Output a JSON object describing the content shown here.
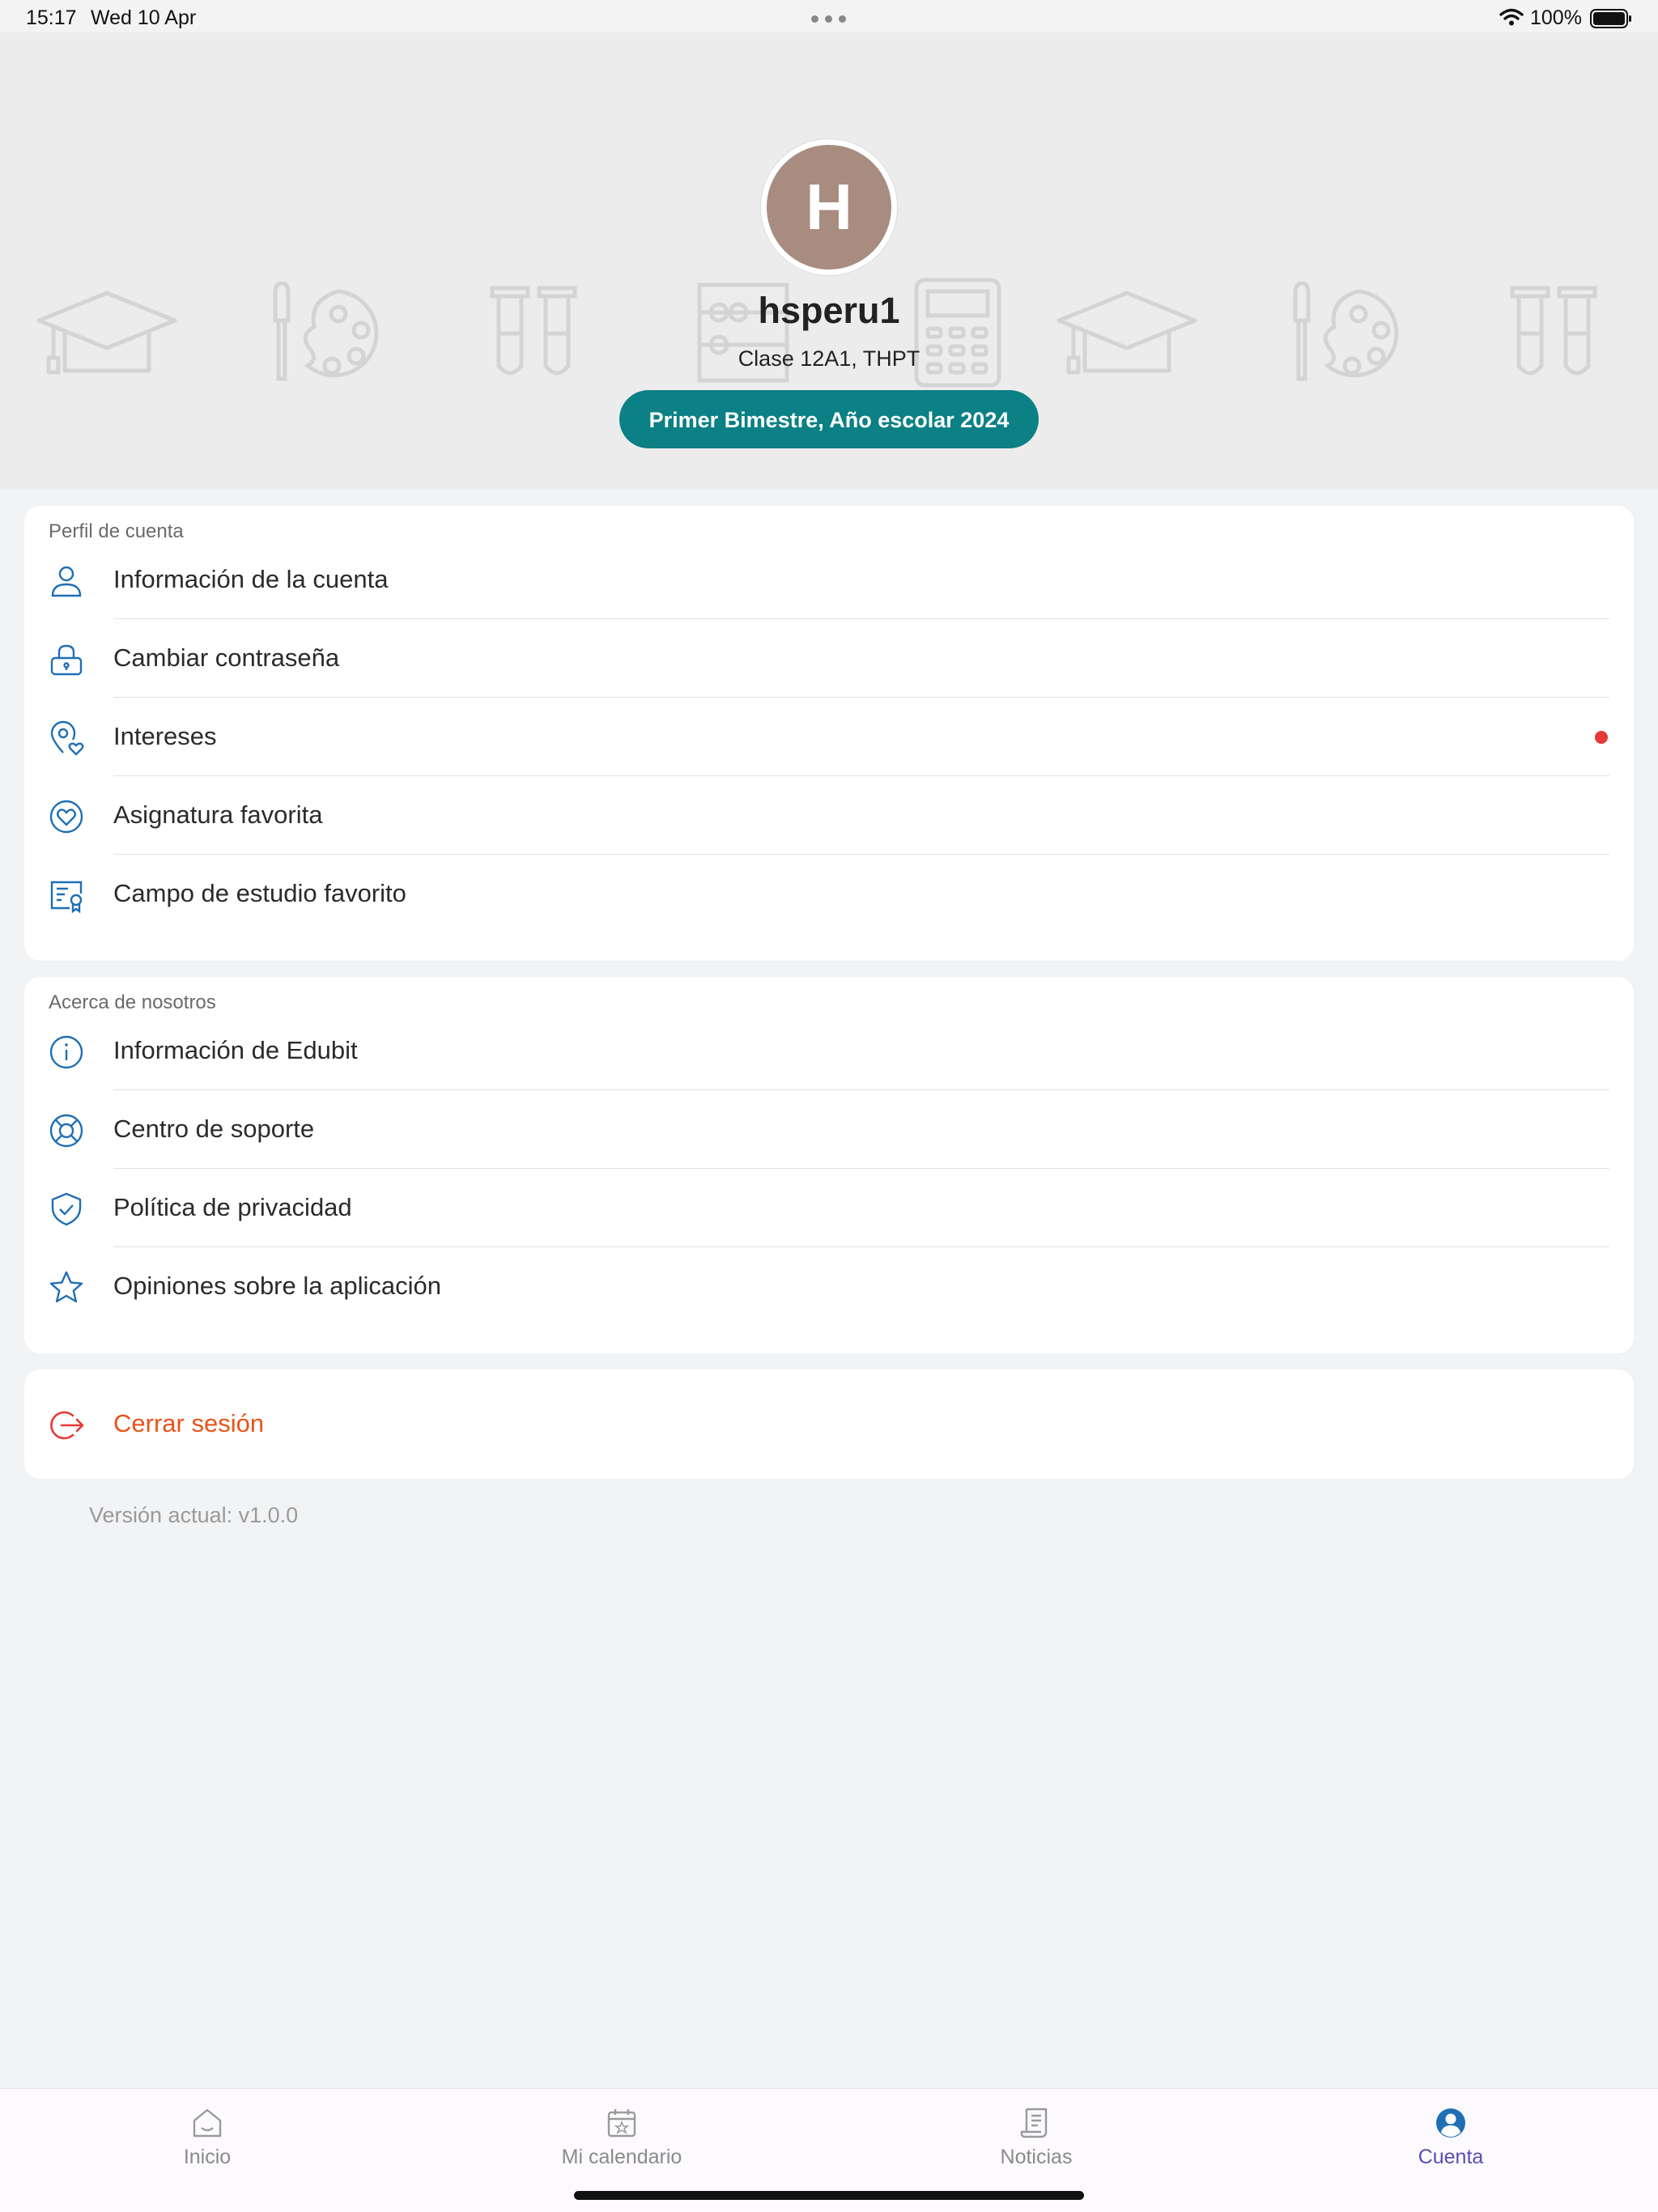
{
  "status_bar": {
    "time": "15:17",
    "date": "Wed 10 Apr",
    "battery": "100%"
  },
  "profile": {
    "avatar_initial": "H",
    "username": "hsperu1",
    "class_info": "Clase 12A1, THPT",
    "term": "Primer Bimestre, Año escolar 2024"
  },
  "account_section": {
    "title": "Perfil de cuenta",
    "items": [
      {
        "label": "Información de la cuenta",
        "icon": "user-icon"
      },
      {
        "label": "Cambiar contraseña",
        "icon": "lock-icon"
      },
      {
        "label": "Intereses",
        "icon": "location-heart-icon",
        "badge": "red-dot"
      },
      {
        "label": "Asignatura favorita",
        "icon": "heart-circle-icon"
      },
      {
        "label": "Campo de estudio favorito",
        "icon": "certificate-icon"
      }
    ]
  },
  "about_section": {
    "title": "Acerca de nosotros",
    "items": [
      {
        "label": "Información de Edubit",
        "icon": "info-icon"
      },
      {
        "label": "Centro de soporte",
        "icon": "lifebuoy-icon"
      },
      {
        "label": "Política de privacidad",
        "icon": "shield-check-icon"
      },
      {
        "label": "Opiniones sobre la aplicación",
        "icon": "star-icon"
      }
    ]
  },
  "logout": {
    "label": "Cerrar sesión",
    "icon": "logout-icon"
  },
  "version": "Versión actual: v1.0.0",
  "tab_bar": {
    "tabs": [
      {
        "label": "Inicio",
        "icon": "home-icon"
      },
      {
        "label": "Mi calendario",
        "icon": "calendar-icon"
      },
      {
        "label": "Noticias",
        "icon": "news-icon"
      },
      {
        "label": "Cuenta",
        "icon": "account-icon",
        "active": true
      }
    ]
  },
  "colors": {
    "accent_teal": "#0b8085",
    "icon_blue": "#1f6fb5",
    "logout_orange": "#e8541a",
    "active_tab": "#5b4bb0",
    "badge_red": "#e53935"
  }
}
